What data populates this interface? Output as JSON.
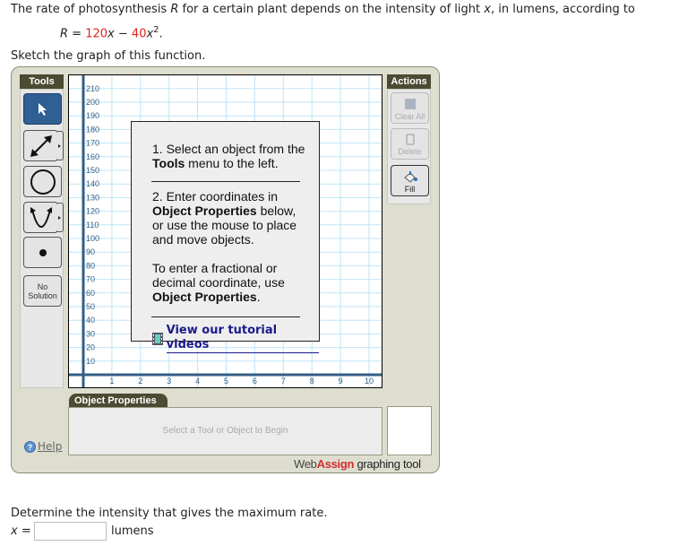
{
  "question": {
    "intro_parts": [
      "The rate of photosynthesis ",
      "R",
      " for a certain plant depends on the intensity of light ",
      "x",
      ", in lumens, according to"
    ],
    "equation": {
      "lhs": "R",
      "eq": " = ",
      "c1": "120",
      "v1": "x",
      "minus": " − ",
      "c2": "40",
      "v2": "x",
      "exp": "2",
      "end": "."
    },
    "instruction": "Sketch the graph of this function.",
    "part2": "Determine the intensity that gives the maximum rate.",
    "answer_label": "x",
    "answer_eq": " =",
    "answer_value": "",
    "answer_unit": "lumens"
  },
  "tool": {
    "tools_header": "Tools",
    "tools": [
      {
        "name": "pointer",
        "icon": "pointer-icon",
        "selected": true
      },
      {
        "name": "line",
        "icon": "double-arrow-line-icon"
      },
      {
        "name": "circle",
        "icon": "circle-icon"
      },
      {
        "name": "parabola",
        "icon": "parabola-icon"
      },
      {
        "name": "point",
        "icon": "point-icon"
      },
      {
        "name": "no-solution",
        "label_1": "No",
        "label_2": "Solution"
      }
    ],
    "actions_header": "Actions",
    "actions": {
      "clear_all": "Clear All",
      "delete": "Delete",
      "fill": "Fill"
    },
    "graph": {
      "x_ticks": [
        "1",
        "2",
        "3",
        "4",
        "5",
        "6",
        "7",
        "8",
        "9",
        "10"
      ],
      "y_ticks": [
        "10",
        "20",
        "30",
        "40",
        "50",
        "60",
        "70",
        "80",
        "90",
        "100",
        "110",
        "120",
        "130",
        "140",
        "150",
        "160",
        "170",
        "180",
        "190",
        "200",
        "210"
      ],
      "xlim": [
        -0.5,
        10.5
      ],
      "ylim": [
        -10,
        220
      ]
    },
    "overlay": {
      "step1_a": "1. Select an object from the ",
      "step1_bold": "Tools",
      "step1_b": " menu to the left.",
      "step2_a": "2. Enter coordinates in ",
      "step2_bold": "Object Properties",
      "step2_b": " below, or use the mouse to place and move objects.",
      "note_a": "To enter a fractional or decimal coordinate, use ",
      "note_bold": "Object Properties",
      "note_b": ".",
      "tutorial_link": "View our tutorial videos"
    },
    "object_properties_tab": "Object Properties",
    "object_properties_hint": "Select a Tool or Object to Begin",
    "help": "Help",
    "brand_web": "Web",
    "brand_assign": "Assign",
    "brand_suffix": " graphing tool",
    "colors": {
      "accent_red": "#e0211b",
      "header": "#4b4b33",
      "selected_tool": "#2f5f93",
      "grid": "#bfe6f7",
      "axis": "#345e84"
    }
  }
}
